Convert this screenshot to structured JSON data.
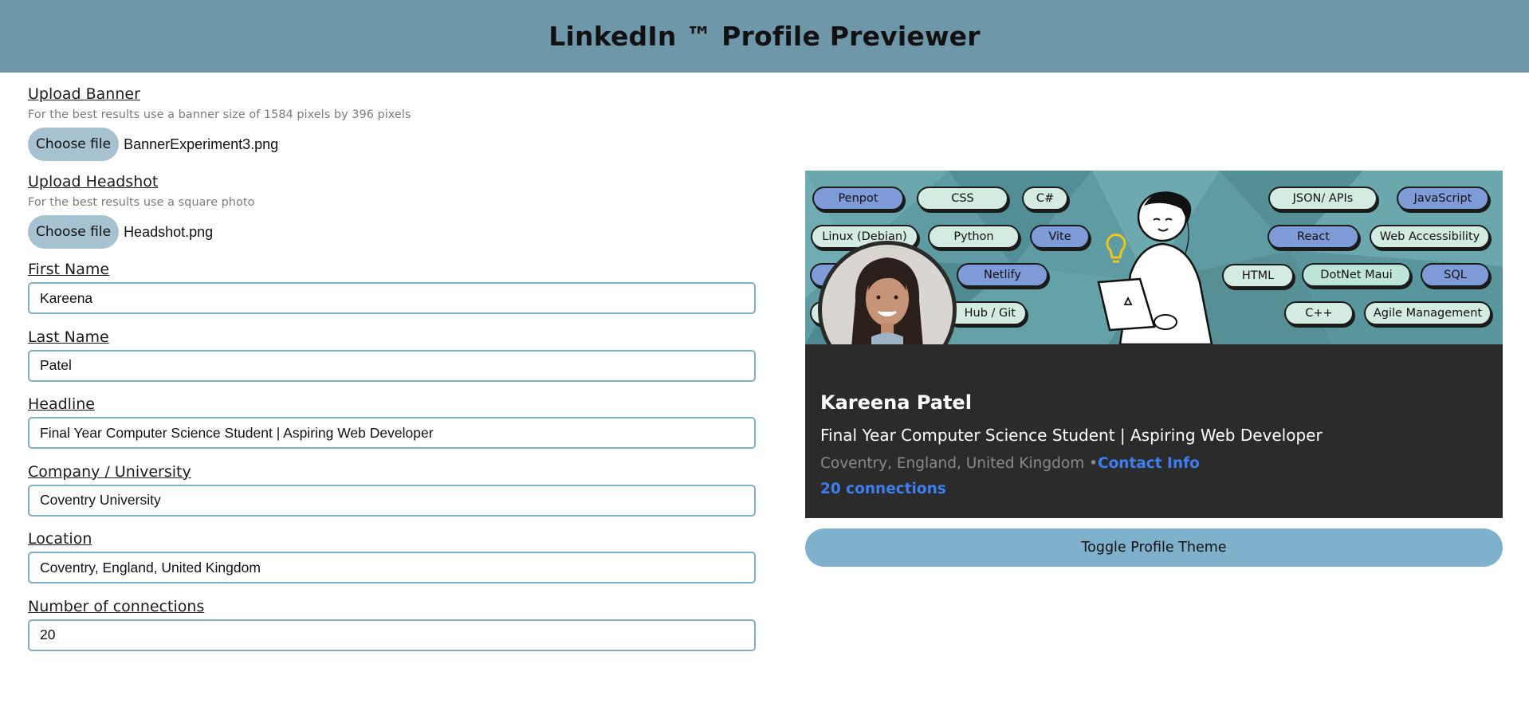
{
  "app": {
    "title": "LinkedIn ™ Profile Previewer"
  },
  "form": {
    "banner": {
      "label": "Upload Banner",
      "hint": "For the best results use a banner size of 1584 pixels by 396 pixels",
      "button": "Choose file",
      "file": "BannerExperiment3.png"
    },
    "headshot": {
      "label": "Upload Headshot",
      "hint": "For the best results use a square photo",
      "button": "Choose file",
      "file": "Headshot.png"
    },
    "first_name": {
      "label": "First Name",
      "value": "Kareena"
    },
    "last_name": {
      "label": "Last Name",
      "value": "Patel"
    },
    "headline": {
      "label": "Headline",
      "value": "Final Year Computer Science Student | Aspiring Web Developer"
    },
    "company": {
      "label": "Company / University",
      "value": "Coventry University"
    },
    "location": {
      "label": "Location",
      "value": "Coventry, England, United Kingdom"
    },
    "connections": {
      "label": "Number of connections",
      "value": "20"
    }
  },
  "banner_tags": {
    "penpot": "Penpot",
    "css": "CSS",
    "csharp": "C#",
    "linux": "Linux (Debian)",
    "python": "Python",
    "vite": "Vite",
    "netlify": "Netlify",
    "github": "Hub / Git",
    "json": "JSON/ APIs",
    "javascript": "JavaScript",
    "react": "React",
    "web_accessibility": "Web Accessibility",
    "html": "HTML",
    "dotnet_maui": "DotNet Maui",
    "sql": "SQL",
    "cpp": "C++",
    "agile": "Agile Management"
  },
  "profile": {
    "name": "Kareena Patel",
    "headline": "Final Year Computer Science Student | Aspiring Web Developer",
    "location": "Coventry, England, United Kingdom",
    "separator": " •",
    "contact_info": "Contact Info",
    "connections": "20 connections"
  },
  "toggle_button": "Toggle Profile Theme",
  "colors": {
    "header": "#6f97aa",
    "card": "#2b2b2b",
    "link": "#3d7ff0",
    "toggle": "#7fb1cd",
    "input_border": "#7fafc6"
  }
}
